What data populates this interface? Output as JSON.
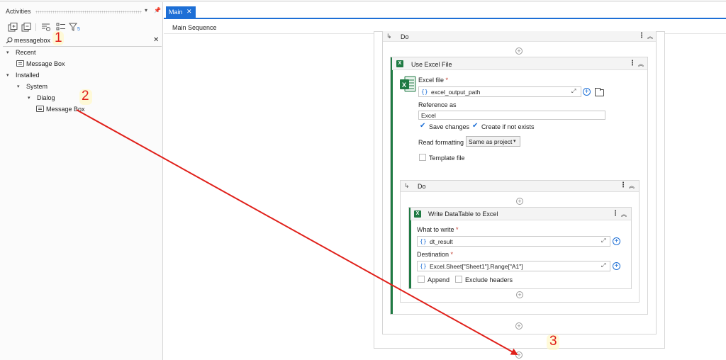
{
  "activities": {
    "title": "Activities",
    "search_value": "messagebox",
    "tree": [
      {
        "label": "Recent",
        "level": 0,
        "kind": "group"
      },
      {
        "label": "Message Box",
        "level": 1,
        "kind": "activity"
      },
      {
        "label": "Installed",
        "level": 0,
        "kind": "group"
      },
      {
        "label": "System",
        "level": 1,
        "kind": "group"
      },
      {
        "label": "Dialog",
        "level": 2,
        "kind": "group"
      },
      {
        "label": "Message Box",
        "level": 3,
        "kind": "activity"
      }
    ]
  },
  "designer": {
    "tab": "Main",
    "breadcrumb": "Main Sequence",
    "outer_do": "Do",
    "use_excel": {
      "title": "Use Excel File",
      "excel_file_label": "Excel file",
      "required_mark": "*",
      "excel_file_value": "excel_output_path",
      "reference_label": "Reference as",
      "reference_value": "Excel",
      "save_changes": "Save changes",
      "create_if_not_exists": "Create if not exists",
      "read_formatting_label": "Read formatting",
      "read_formatting_value": "Same as project",
      "template_file": "Template file"
    },
    "inner_do": "Do",
    "write_dt": {
      "title": "Write DataTable to Excel",
      "what_label": "What to write",
      "what_value": "dt_result",
      "dest_label": "Destination",
      "dest_value": "Excel.Sheet[\"Sheet1\"].Range[\"A1\"]",
      "append": "Append",
      "exclude_headers": "Exclude headers"
    },
    "brace_glyph": "{}"
  },
  "annotations": {
    "step1": "1",
    "step2": "2",
    "step3": "3",
    "arrow_color": "#e0201a"
  },
  "icons": [
    "search-icon",
    "clear-icon",
    "chevron-down-icon",
    "chevron-right-icon",
    "message-box-icon",
    "excel-icon",
    "folder-icon",
    "plus-icon",
    "kebab-icon",
    "collapse-icon",
    "expand-icon",
    "pin-icon"
  ],
  "colors": {
    "accent": "#1d6fd6",
    "excel": "#1f7a43",
    "annotation": "#e0201a"
  }
}
